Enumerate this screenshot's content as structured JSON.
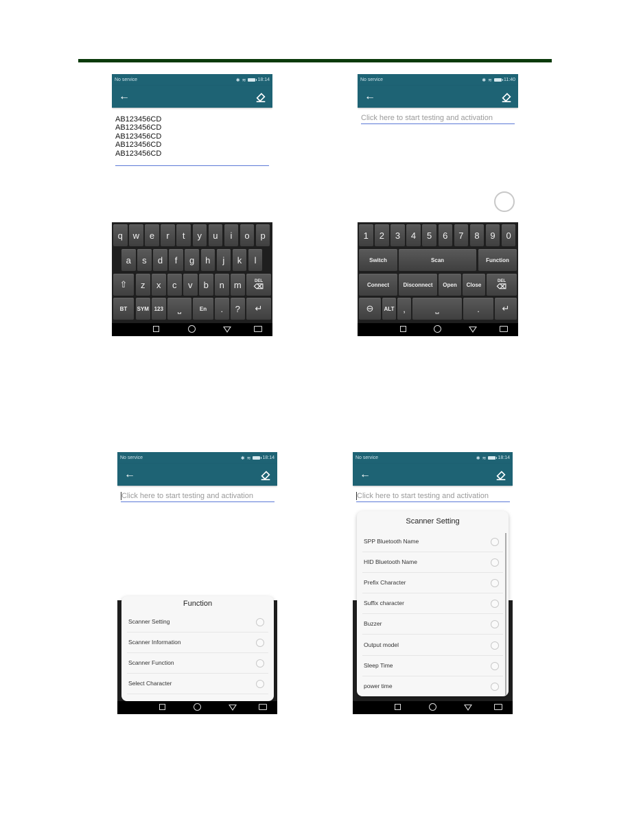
{
  "status_bar": {
    "carrier": "No service",
    "time_a": "18:14",
    "time_b": "11:40",
    "time_c": "18:14",
    "time_d": "18:14"
  },
  "icons": {
    "back": "arrow-left-icon",
    "clear": "eraser-icon"
  },
  "screen_a": {
    "scanned_codes": [
      "AB123456CD",
      "AB123456CD",
      "AB123456CD",
      "AB123456CD",
      "AB123456CD"
    ],
    "keyboard_rows": [
      [
        "q",
        "w",
        "e",
        "r",
        "t",
        "y",
        "u",
        "i",
        "o",
        "p"
      ],
      [
        "a",
        "s",
        "d",
        "f",
        "g",
        "h",
        "j",
        "k",
        "l"
      ],
      [
        "shift",
        "z",
        "x",
        "c",
        "v",
        "b",
        "n",
        "m",
        "DEL"
      ],
      [
        "BT",
        "SYM",
        "123",
        "space",
        "En",
        ".",
        "?",
        "enter"
      ]
    ]
  },
  "screen_b": {
    "input_placeholder": "Click here to start testing and activation",
    "keyboard": {
      "digits": [
        "1",
        "2",
        "3",
        "4",
        "5",
        "6",
        "7",
        "8",
        "9",
        "0"
      ],
      "row2": [
        "Switch",
        "Scan",
        "Function"
      ],
      "row3": [
        "Connect",
        "Disconnect",
        "Open",
        "Close",
        "DEL"
      ],
      "row4": [
        "minus",
        "ALT",
        ",",
        "space",
        ".",
        "enter"
      ]
    }
  },
  "screen_c": {
    "input_placeholder": "Click here to start testing and activation",
    "dialog": {
      "title": "Function",
      "items": [
        "Scanner Setting",
        "Scanner Information",
        "Scanner Function",
        "Select Character"
      ]
    }
  },
  "screen_d": {
    "input_placeholder": "Click here to start testing and activation",
    "dialog": {
      "title": "Scanner Setting",
      "items": [
        "SPP Bluetooth Name",
        "HID Bluetooth Name",
        "Prefix Character",
        "Suffix character",
        "Buzzer",
        "Output model",
        "Sleep Time",
        "power time"
      ]
    }
  },
  "labels": {
    "del": "DEL",
    "space": "⎵"
  }
}
